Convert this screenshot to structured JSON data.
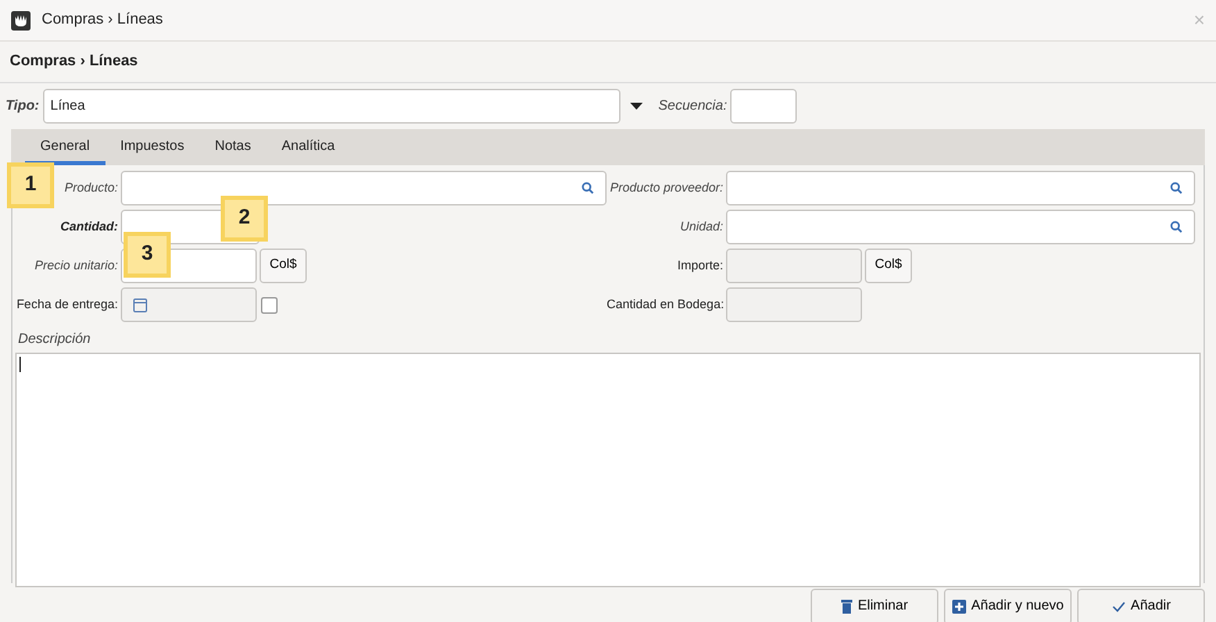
{
  "window": {
    "title": "Compras › Líneas",
    "close": "×"
  },
  "header": "Compras › Líneas",
  "tipo": {
    "label": "Tipo:",
    "value": "Línea"
  },
  "secuencia": {
    "label": "Secuencia:"
  },
  "tabs": [
    {
      "label": "General",
      "selected": true
    },
    {
      "label": "Impuestos",
      "selected": false
    },
    {
      "label": "Notas",
      "selected": false
    },
    {
      "label": "Analítica",
      "selected": false
    }
  ],
  "rows": [
    {
      "left": {
        "label": "Producto:",
        "kind": "search",
        "disabled": false
      },
      "right": {
        "label": "Producto proveedor:",
        "kind": "search",
        "disabled": false
      }
    },
    {
      "left": {
        "label": "Cantidad:",
        "kind": "short",
        "disabled": false
      },
      "right": {
        "label": "Unidad:",
        "kind": "search",
        "disabled": false
      }
    },
    {
      "left": {
        "label": "Precio unitario:",
        "kind": "currency",
        "currency": "Col$",
        "disabled": false
      },
      "right": {
        "label": "Importe:",
        "kind": "currency",
        "currency": "Col$",
        "disabled": true
      }
    },
    {
      "left": {
        "label": "Fecha de entrega:",
        "kind": "date",
        "disabled": true,
        "checked": false
      },
      "right": {
        "label": "Cantidad en Bodega:",
        "kind": "short",
        "disabled": true
      }
    }
  ],
  "description": {
    "label": "Descripción"
  },
  "callouts": [
    "1",
    "2",
    "3"
  ],
  "buttons": [
    {
      "label": "Eliminar",
      "kind": "delete"
    },
    {
      "label": "Añadir y nuevo",
      "kind": "add"
    },
    {
      "label": "Añadir",
      "kind": "ok"
    }
  ]
}
